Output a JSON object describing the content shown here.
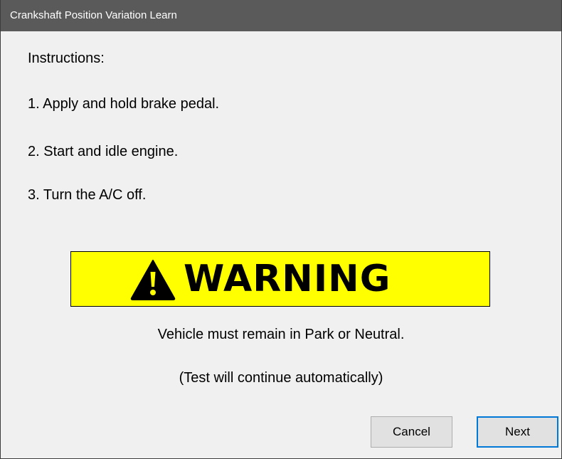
{
  "window": {
    "title": "Crankshaft Position Variation Learn"
  },
  "instructions": {
    "heading": "Instructions:",
    "steps": [
      "1. Apply and hold brake pedal.",
      "2. Start and idle engine.",
      "3. Turn the A/C off."
    ]
  },
  "warning": {
    "icon": "warning-triangle-icon",
    "label": "WARNING",
    "background_color": "#ffff00",
    "message": "Vehicle must remain in Park or Neutral.",
    "note": "(Test will continue automatically)"
  },
  "buttons": {
    "cancel_label": "Cancel",
    "next_label": "Next"
  },
  "colors": {
    "titlebar": "#5a5a5a",
    "focus_border": "#0078d7"
  }
}
